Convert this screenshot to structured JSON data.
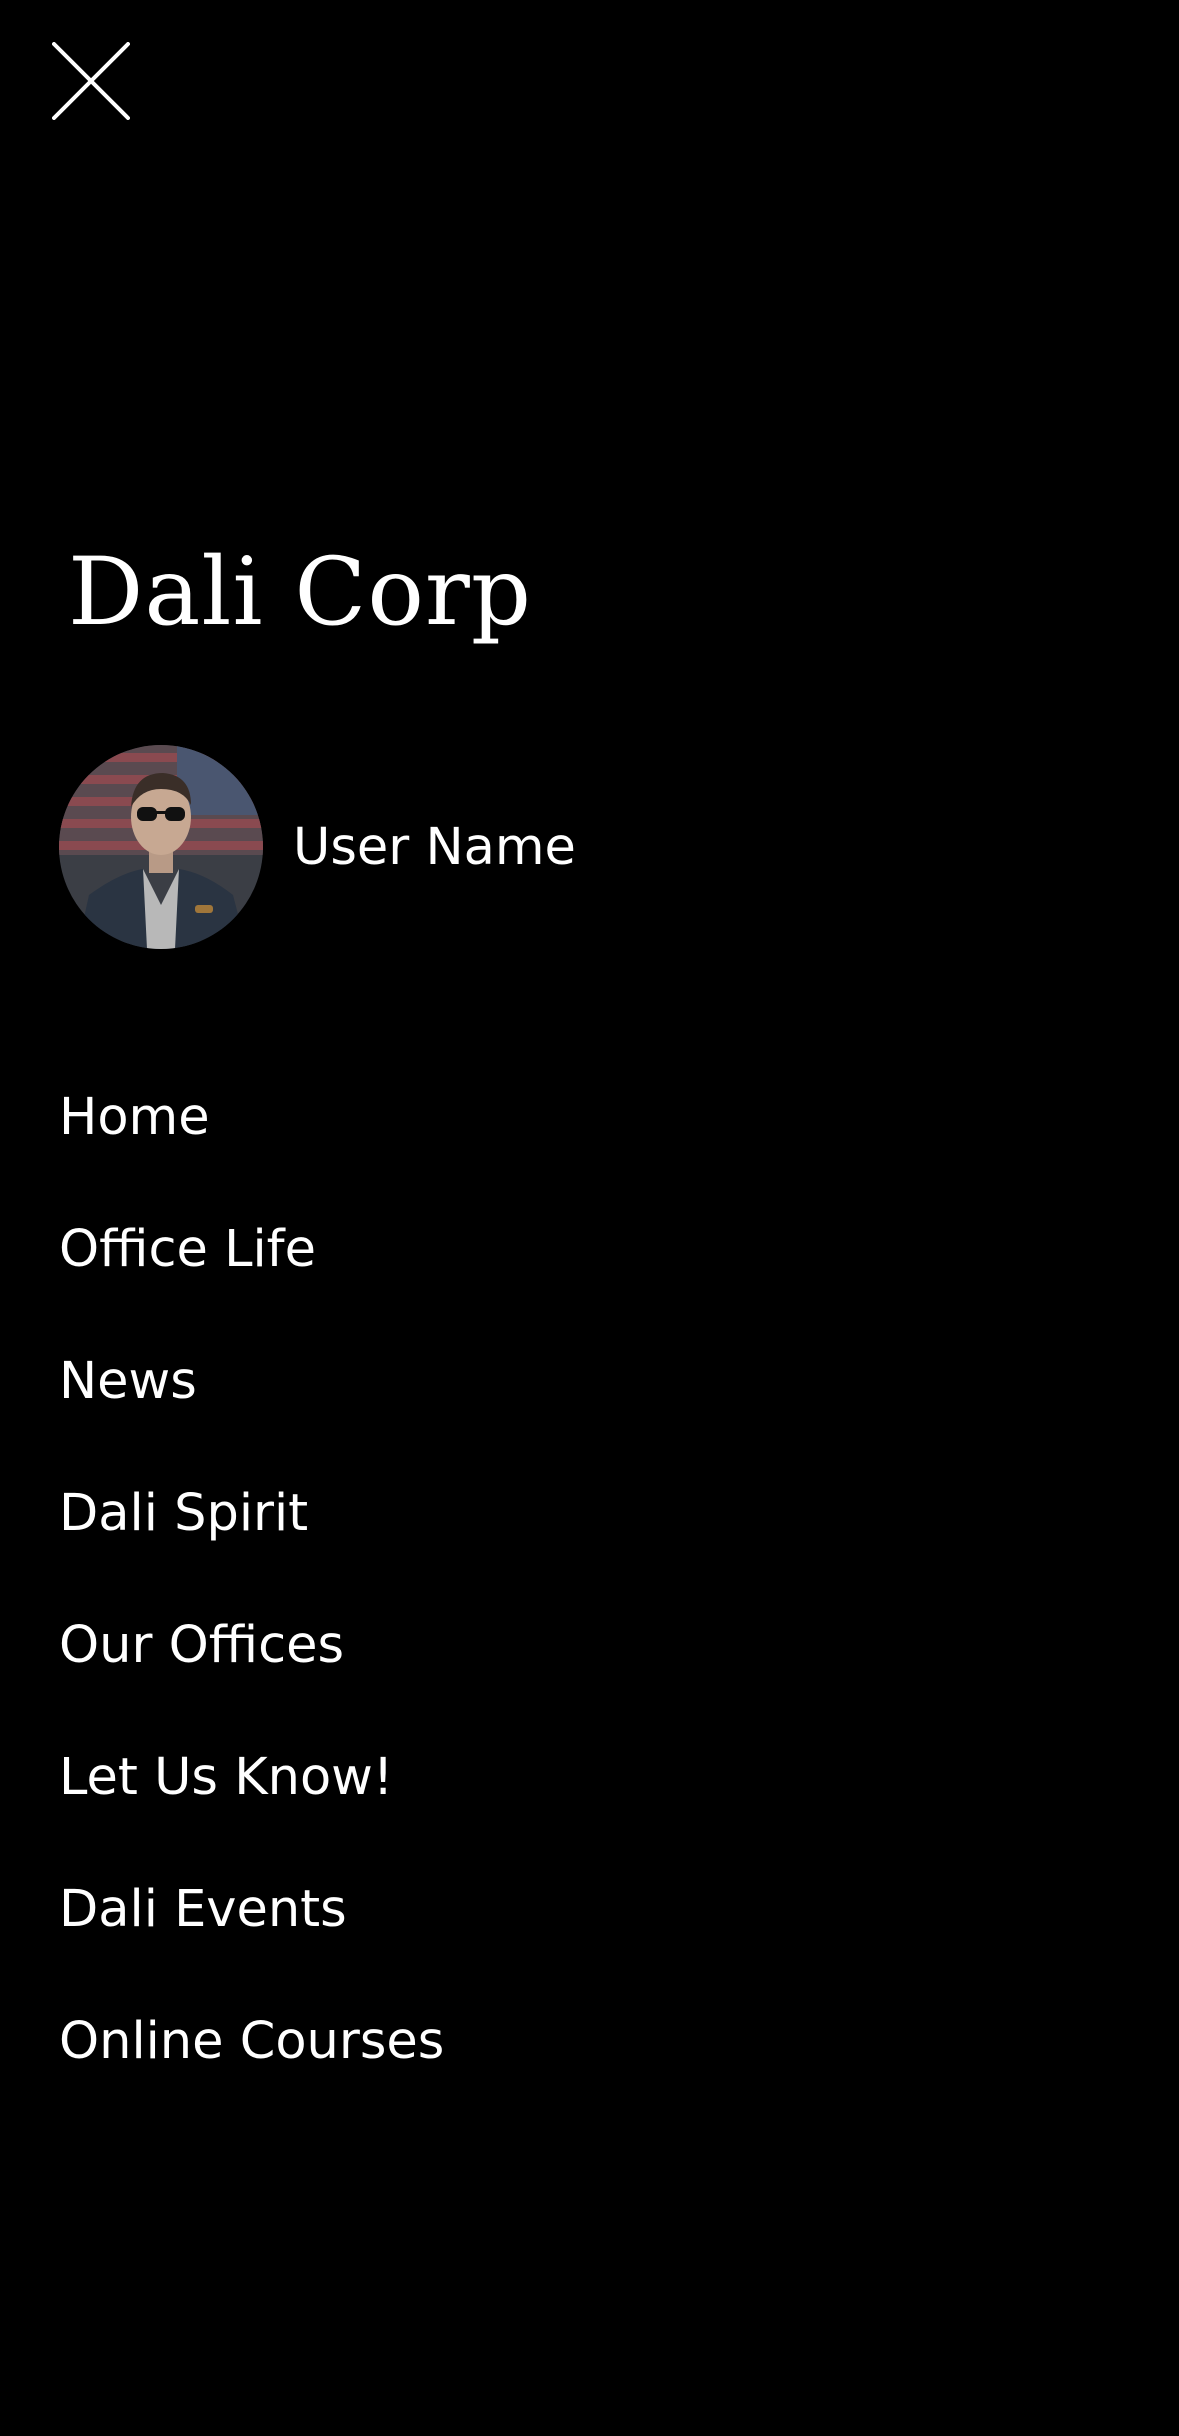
{
  "header": {
    "close_icon": "close-icon"
  },
  "brand": {
    "title": "Dali Corp"
  },
  "user": {
    "name": "User Name",
    "avatar_icon": "avatar-photo"
  },
  "menu": {
    "items": [
      {
        "label": "Home"
      },
      {
        "label": "Office Life"
      },
      {
        "label": "News"
      },
      {
        "label": "Dali Spirit"
      },
      {
        "label": "Our Offices"
      },
      {
        "label": "Let Us Know!"
      },
      {
        "label": "Dali Events"
      },
      {
        "label": "Online Courses"
      }
    ]
  },
  "colors": {
    "background": "#000000",
    "text": "#ffffff"
  }
}
